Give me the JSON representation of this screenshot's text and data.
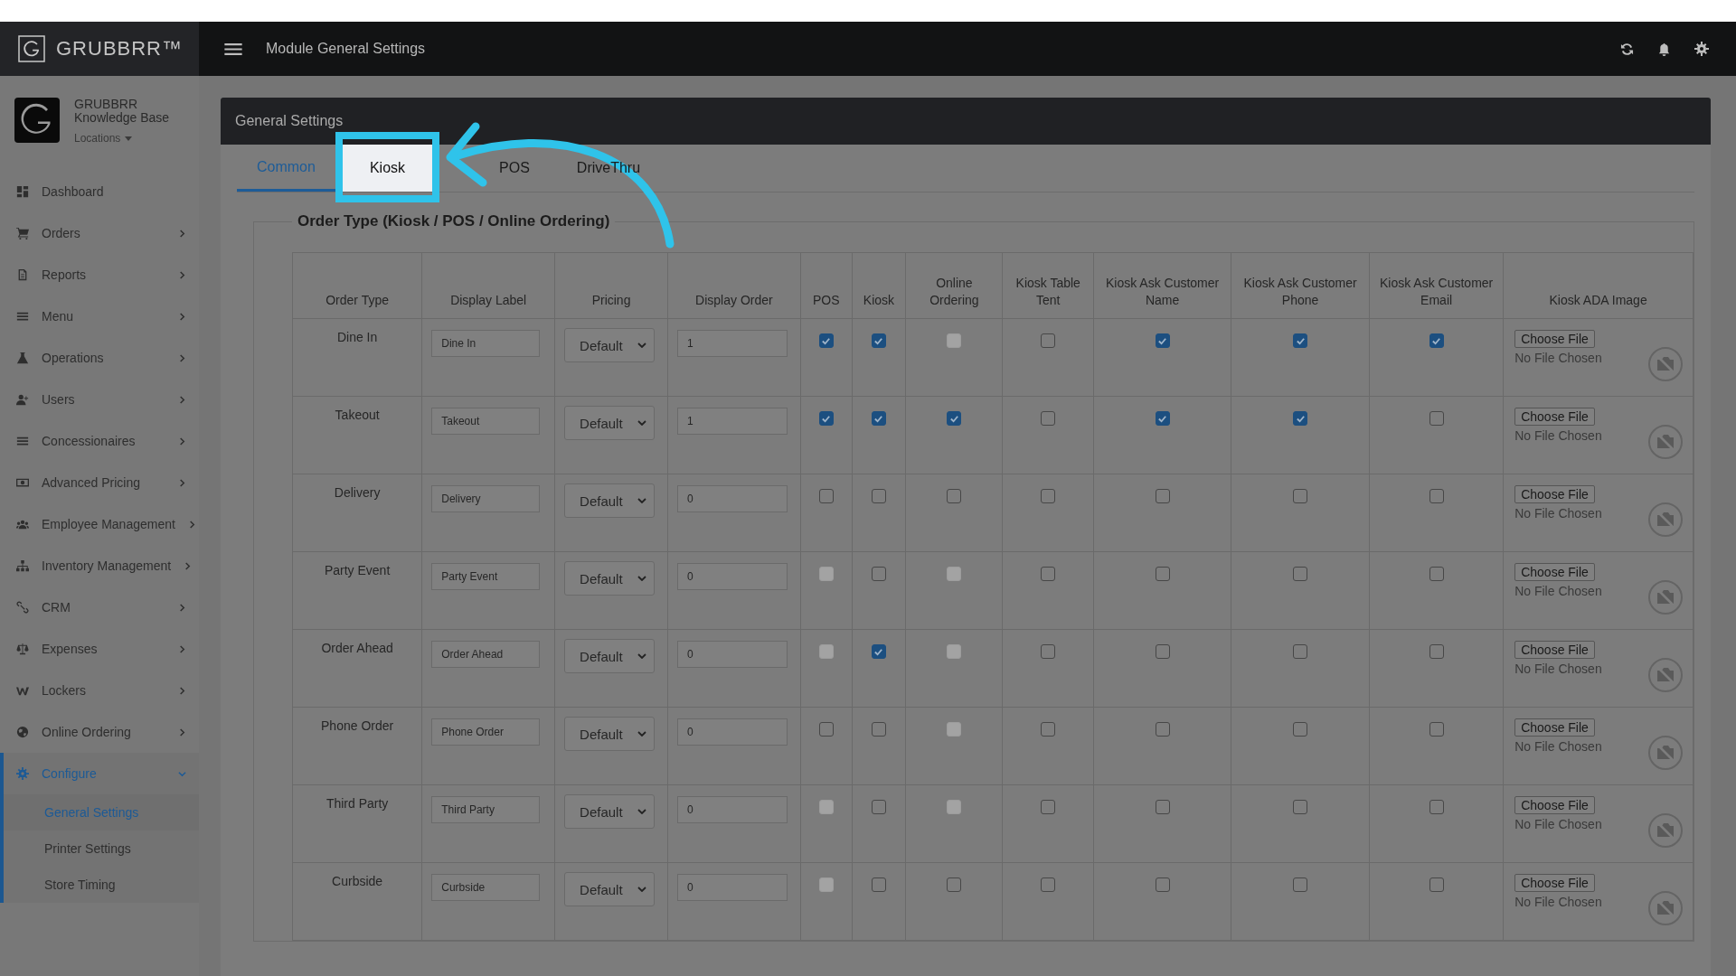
{
  "brand": {
    "name": "GRUBBRR™"
  },
  "top_bar": {
    "title": "Module General Settings"
  },
  "profile": {
    "name": "GRUBBRR",
    "subtitle": "Knowledge Base",
    "locations": "Locations"
  },
  "sidebar": {
    "items": [
      {
        "label": "Dashboard",
        "kind": "link",
        "selected": false
      },
      {
        "label": "Orders",
        "kind": "group",
        "expanded": false,
        "selected": false
      },
      {
        "label": "Reports",
        "kind": "group",
        "expanded": false,
        "selected": false
      },
      {
        "label": "Menu",
        "kind": "group",
        "expanded": false,
        "selected": false
      },
      {
        "label": "Operations",
        "kind": "group",
        "expanded": false,
        "selected": false
      },
      {
        "label": "Users",
        "kind": "group",
        "expanded": false,
        "selected": false
      },
      {
        "label": "Concessionaires",
        "kind": "group",
        "expanded": false,
        "selected": false
      },
      {
        "label": "Advanced Pricing",
        "kind": "group",
        "expanded": false,
        "selected": false
      },
      {
        "label": "Employee Management",
        "kind": "group",
        "expanded": false,
        "selected": false
      },
      {
        "label": "Inventory Management",
        "kind": "group",
        "expanded": false,
        "selected": false
      },
      {
        "label": "CRM",
        "kind": "group",
        "expanded": false,
        "selected": false
      },
      {
        "label": "Expenses",
        "kind": "group",
        "expanded": false,
        "selected": false
      },
      {
        "label": "Lockers",
        "kind": "group",
        "expanded": false,
        "selected": false
      },
      {
        "label": "Online Ordering",
        "kind": "group",
        "expanded": false,
        "selected": false
      },
      {
        "label": "Configure",
        "kind": "group",
        "expanded": true,
        "selected": true,
        "children": [
          {
            "label": "General Settings",
            "selected": true
          },
          {
            "label": "Printer Settings",
            "selected": false
          },
          {
            "label": "Store Timing",
            "selected": false
          }
        ]
      }
    ]
  },
  "panel": {
    "title": "General Settings",
    "tabs": [
      {
        "label": "Common",
        "selected": true,
        "highlighted": false
      },
      {
        "label": "Kiosk",
        "selected": false,
        "highlighted": true
      },
      {
        "label": "POS",
        "selected": false,
        "highlighted": false
      },
      {
        "label": "DriveThru",
        "selected": false,
        "highlighted": false
      }
    ],
    "legend": "Order Type (Kiosk / POS / Online Ordering)",
    "columns": [
      "Order Type",
      "Display Label",
      "Pricing",
      "Display Order",
      "POS",
      "Kiosk",
      "Online Ordering",
      "Kiosk Table Tent",
      "Kiosk Ask Customer Name",
      "Kiosk Ask Customer Phone",
      "Kiosk Ask Customer Email",
      "Kiosk ADA Image"
    ],
    "rows": [
      {
        "order_type": "Dine In",
        "display_label": "Dine In",
        "pricing": "Default",
        "display_order": "1",
        "checks": [
          {
            "checked": true,
            "disabled": false
          },
          {
            "checked": true,
            "disabled": false
          },
          {
            "checked": false,
            "disabled": true
          },
          {
            "checked": false,
            "disabled": false
          },
          {
            "checked": true,
            "disabled": false
          },
          {
            "checked": true,
            "disabled": false
          },
          {
            "checked": true,
            "disabled": false
          }
        ],
        "file_button": "Choose File",
        "file_status": "No File Chosen"
      },
      {
        "order_type": "Takeout",
        "display_label": "Takeout",
        "pricing": "Default",
        "display_order": "1",
        "checks": [
          {
            "checked": true,
            "disabled": false
          },
          {
            "checked": true,
            "disabled": false
          },
          {
            "checked": true,
            "disabled": false
          },
          {
            "checked": false,
            "disabled": false
          },
          {
            "checked": true,
            "disabled": false
          },
          {
            "checked": true,
            "disabled": false
          },
          {
            "checked": false,
            "disabled": false
          }
        ],
        "file_button": "Choose File",
        "file_status": "No File Chosen"
      },
      {
        "order_type": "Delivery",
        "display_label": "Delivery",
        "pricing": "Default",
        "display_order": "0",
        "checks": [
          {
            "checked": false,
            "disabled": false
          },
          {
            "checked": false,
            "disabled": false
          },
          {
            "checked": false,
            "disabled": false
          },
          {
            "checked": false,
            "disabled": false
          },
          {
            "checked": false,
            "disabled": false
          },
          {
            "checked": false,
            "disabled": false
          },
          {
            "checked": false,
            "disabled": false
          }
        ],
        "file_button": "Choose File",
        "file_status": "No File Chosen"
      },
      {
        "order_type": "Party Event",
        "display_label": "Party Event",
        "pricing": "Default",
        "display_order": "0",
        "checks": [
          {
            "checked": false,
            "disabled": true
          },
          {
            "checked": false,
            "disabled": false
          },
          {
            "checked": false,
            "disabled": true
          },
          {
            "checked": false,
            "disabled": false
          },
          {
            "checked": false,
            "disabled": false
          },
          {
            "checked": false,
            "disabled": false
          },
          {
            "checked": false,
            "disabled": false
          }
        ],
        "file_button": "Choose File",
        "file_status": "No File Chosen"
      },
      {
        "order_type": "Order Ahead",
        "display_label": "Order Ahead",
        "pricing": "Default",
        "display_order": "0",
        "checks": [
          {
            "checked": false,
            "disabled": true
          },
          {
            "checked": true,
            "disabled": false
          },
          {
            "checked": false,
            "disabled": true
          },
          {
            "checked": false,
            "disabled": false
          },
          {
            "checked": false,
            "disabled": false
          },
          {
            "checked": false,
            "disabled": false
          },
          {
            "checked": false,
            "disabled": false
          }
        ],
        "file_button": "Choose File",
        "file_status": "No File Chosen"
      },
      {
        "order_type": "Phone Order",
        "display_label": "Phone Order",
        "pricing": "Default",
        "display_order": "0",
        "checks": [
          {
            "checked": false,
            "disabled": false
          },
          {
            "checked": false,
            "disabled": false
          },
          {
            "checked": false,
            "disabled": true
          },
          {
            "checked": false,
            "disabled": false
          },
          {
            "checked": false,
            "disabled": false
          },
          {
            "checked": false,
            "disabled": false
          },
          {
            "checked": false,
            "disabled": false
          }
        ],
        "file_button": "Choose File",
        "file_status": "No File Chosen"
      },
      {
        "order_type": "Third Party",
        "display_label": "Third Party",
        "pricing": "Default",
        "display_order": "0",
        "checks": [
          {
            "checked": false,
            "disabled": true
          },
          {
            "checked": false,
            "disabled": false
          },
          {
            "checked": false,
            "disabled": true
          },
          {
            "checked": false,
            "disabled": false
          },
          {
            "checked": false,
            "disabled": false
          },
          {
            "checked": false,
            "disabled": false
          },
          {
            "checked": false,
            "disabled": false
          }
        ],
        "file_button": "Choose File",
        "file_status": "No File Chosen"
      },
      {
        "order_type": "Curbside",
        "display_label": "Curbside",
        "pricing": "Default",
        "display_order": "0",
        "checks": [
          {
            "checked": false,
            "disabled": true
          },
          {
            "checked": false,
            "disabled": false
          },
          {
            "checked": false,
            "disabled": false
          },
          {
            "checked": false,
            "disabled": false
          },
          {
            "checked": false,
            "disabled": false
          },
          {
            "checked": false,
            "disabled": false
          },
          {
            "checked": false,
            "disabled": false
          }
        ],
        "file_button": "Choose File",
        "file_status": "No File Chosen"
      }
    ]
  }
}
